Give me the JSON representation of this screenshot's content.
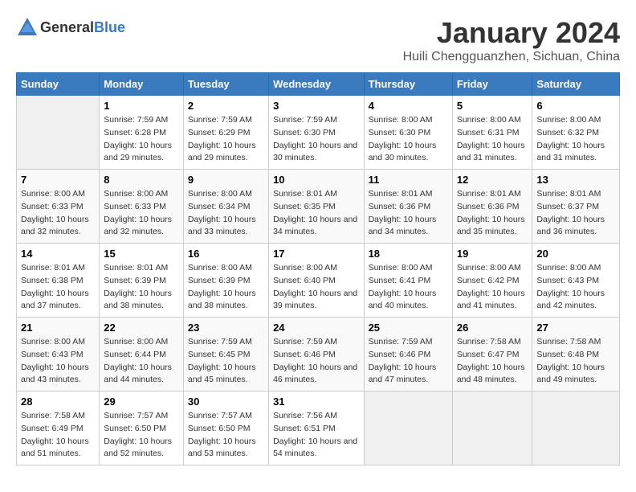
{
  "header": {
    "logo": {
      "general": "General",
      "blue": "Blue"
    },
    "title": "January 2024",
    "subtitle": "Huili Chengguanzhen, Sichuan, China"
  },
  "days_of_week": [
    "Sunday",
    "Monday",
    "Tuesday",
    "Wednesday",
    "Thursday",
    "Friday",
    "Saturday"
  ],
  "weeks": [
    [
      {
        "num": "",
        "sunrise": "",
        "sunset": "",
        "daylight": ""
      },
      {
        "num": "1",
        "sunrise": "Sunrise: 7:59 AM",
        "sunset": "Sunset: 6:28 PM",
        "daylight": "Daylight: 10 hours and 29 minutes."
      },
      {
        "num": "2",
        "sunrise": "Sunrise: 7:59 AM",
        "sunset": "Sunset: 6:29 PM",
        "daylight": "Daylight: 10 hours and 29 minutes."
      },
      {
        "num": "3",
        "sunrise": "Sunrise: 7:59 AM",
        "sunset": "Sunset: 6:30 PM",
        "daylight": "Daylight: 10 hours and 30 minutes."
      },
      {
        "num": "4",
        "sunrise": "Sunrise: 8:00 AM",
        "sunset": "Sunset: 6:30 PM",
        "daylight": "Daylight: 10 hours and 30 minutes."
      },
      {
        "num": "5",
        "sunrise": "Sunrise: 8:00 AM",
        "sunset": "Sunset: 6:31 PM",
        "daylight": "Daylight: 10 hours and 31 minutes."
      },
      {
        "num": "6",
        "sunrise": "Sunrise: 8:00 AM",
        "sunset": "Sunset: 6:32 PM",
        "daylight": "Daylight: 10 hours and 31 minutes."
      }
    ],
    [
      {
        "num": "7",
        "sunrise": "Sunrise: 8:00 AM",
        "sunset": "Sunset: 6:33 PM",
        "daylight": "Daylight: 10 hours and 32 minutes."
      },
      {
        "num": "8",
        "sunrise": "Sunrise: 8:00 AM",
        "sunset": "Sunset: 6:33 PM",
        "daylight": "Daylight: 10 hours and 32 minutes."
      },
      {
        "num": "9",
        "sunrise": "Sunrise: 8:00 AM",
        "sunset": "Sunset: 6:34 PM",
        "daylight": "Daylight: 10 hours and 33 minutes."
      },
      {
        "num": "10",
        "sunrise": "Sunrise: 8:01 AM",
        "sunset": "Sunset: 6:35 PM",
        "daylight": "Daylight: 10 hours and 34 minutes."
      },
      {
        "num": "11",
        "sunrise": "Sunrise: 8:01 AM",
        "sunset": "Sunset: 6:36 PM",
        "daylight": "Daylight: 10 hours and 34 minutes."
      },
      {
        "num": "12",
        "sunrise": "Sunrise: 8:01 AM",
        "sunset": "Sunset: 6:36 PM",
        "daylight": "Daylight: 10 hours and 35 minutes."
      },
      {
        "num": "13",
        "sunrise": "Sunrise: 8:01 AM",
        "sunset": "Sunset: 6:37 PM",
        "daylight": "Daylight: 10 hours and 36 minutes."
      }
    ],
    [
      {
        "num": "14",
        "sunrise": "Sunrise: 8:01 AM",
        "sunset": "Sunset: 6:38 PM",
        "daylight": "Daylight: 10 hours and 37 minutes."
      },
      {
        "num": "15",
        "sunrise": "Sunrise: 8:01 AM",
        "sunset": "Sunset: 6:39 PM",
        "daylight": "Daylight: 10 hours and 38 minutes."
      },
      {
        "num": "16",
        "sunrise": "Sunrise: 8:00 AM",
        "sunset": "Sunset: 6:39 PM",
        "daylight": "Daylight: 10 hours and 38 minutes."
      },
      {
        "num": "17",
        "sunrise": "Sunrise: 8:00 AM",
        "sunset": "Sunset: 6:40 PM",
        "daylight": "Daylight: 10 hours and 39 minutes."
      },
      {
        "num": "18",
        "sunrise": "Sunrise: 8:00 AM",
        "sunset": "Sunset: 6:41 PM",
        "daylight": "Daylight: 10 hours and 40 minutes."
      },
      {
        "num": "19",
        "sunrise": "Sunrise: 8:00 AM",
        "sunset": "Sunset: 6:42 PM",
        "daylight": "Daylight: 10 hours and 41 minutes."
      },
      {
        "num": "20",
        "sunrise": "Sunrise: 8:00 AM",
        "sunset": "Sunset: 6:43 PM",
        "daylight": "Daylight: 10 hours and 42 minutes."
      }
    ],
    [
      {
        "num": "21",
        "sunrise": "Sunrise: 8:00 AM",
        "sunset": "Sunset: 6:43 PM",
        "daylight": "Daylight: 10 hours and 43 minutes."
      },
      {
        "num": "22",
        "sunrise": "Sunrise: 8:00 AM",
        "sunset": "Sunset: 6:44 PM",
        "daylight": "Daylight: 10 hours and 44 minutes."
      },
      {
        "num": "23",
        "sunrise": "Sunrise: 7:59 AM",
        "sunset": "Sunset: 6:45 PM",
        "daylight": "Daylight: 10 hours and 45 minutes."
      },
      {
        "num": "24",
        "sunrise": "Sunrise: 7:59 AM",
        "sunset": "Sunset: 6:46 PM",
        "daylight": "Daylight: 10 hours and 46 minutes."
      },
      {
        "num": "25",
        "sunrise": "Sunrise: 7:59 AM",
        "sunset": "Sunset: 6:46 PM",
        "daylight": "Daylight: 10 hours and 47 minutes."
      },
      {
        "num": "26",
        "sunrise": "Sunrise: 7:58 AM",
        "sunset": "Sunset: 6:47 PM",
        "daylight": "Daylight: 10 hours and 48 minutes."
      },
      {
        "num": "27",
        "sunrise": "Sunrise: 7:58 AM",
        "sunset": "Sunset: 6:48 PM",
        "daylight": "Daylight: 10 hours and 49 minutes."
      }
    ],
    [
      {
        "num": "28",
        "sunrise": "Sunrise: 7:58 AM",
        "sunset": "Sunset: 6:49 PM",
        "daylight": "Daylight: 10 hours and 51 minutes."
      },
      {
        "num": "29",
        "sunrise": "Sunrise: 7:57 AM",
        "sunset": "Sunset: 6:50 PM",
        "daylight": "Daylight: 10 hours and 52 minutes."
      },
      {
        "num": "30",
        "sunrise": "Sunrise: 7:57 AM",
        "sunset": "Sunset: 6:50 PM",
        "daylight": "Daylight: 10 hours and 53 minutes."
      },
      {
        "num": "31",
        "sunrise": "Sunrise: 7:56 AM",
        "sunset": "Sunset: 6:51 PM",
        "daylight": "Daylight: 10 hours and 54 minutes."
      },
      {
        "num": "",
        "sunrise": "",
        "sunset": "",
        "daylight": ""
      },
      {
        "num": "",
        "sunrise": "",
        "sunset": "",
        "daylight": ""
      },
      {
        "num": "",
        "sunrise": "",
        "sunset": "",
        "daylight": ""
      }
    ]
  ]
}
